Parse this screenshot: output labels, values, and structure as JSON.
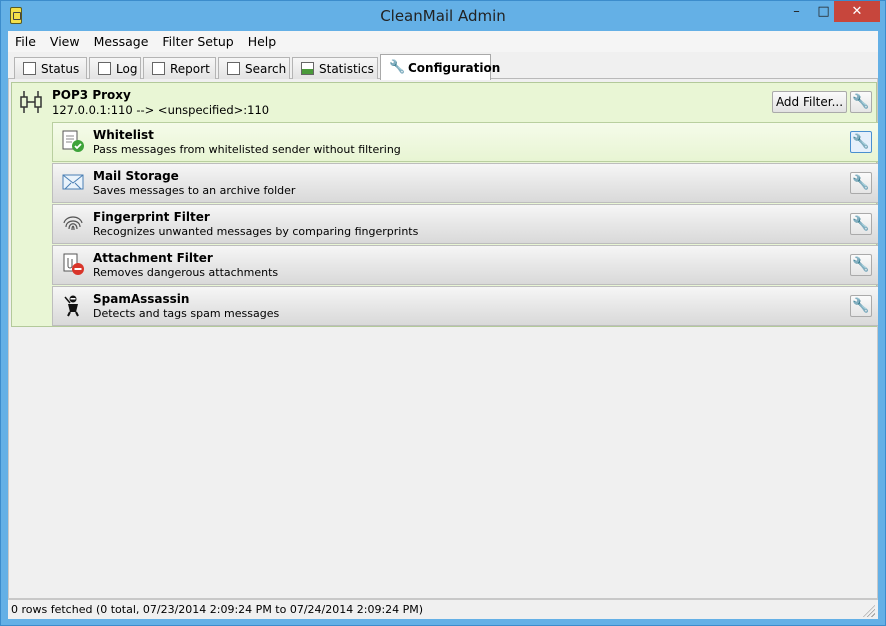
{
  "window": {
    "title": "CleanMail Admin",
    "min": "–",
    "max": "□",
    "close": "✕"
  },
  "menu": [
    "File",
    "View",
    "Message",
    "Filter Setup",
    "Help"
  ],
  "tabs": [
    {
      "label": "Status",
      "icon": "status-icon"
    },
    {
      "label": "Log",
      "icon": "log-icon"
    },
    {
      "label": "Report",
      "icon": "report-icon"
    },
    {
      "label": "Search",
      "icon": "search-icon"
    },
    {
      "label": "Statistics",
      "icon": "statistics-icon"
    },
    {
      "label": "Configuration",
      "icon": "wrench-icon",
      "active": true
    }
  ],
  "proxy": {
    "title": "POP3 Proxy",
    "address": "127.0.0.1:110 --> <unspecified>:110",
    "add_filter_label": "Add Filter...",
    "accent": "#e9f6d5"
  },
  "filters": [
    {
      "title": "Whitelist",
      "description": "Pass messages from whitelisted sender without filtering",
      "icon": "whitelist-icon",
      "selected": true
    },
    {
      "title": "Mail Storage",
      "description": "Saves messages to an archive folder",
      "icon": "mail-storage-icon"
    },
    {
      "title": "Fingerprint Filter",
      "description": "Recognizes unwanted messages by comparing fingerprints",
      "icon": "fingerprint-icon"
    },
    {
      "title": "Attachment Filter",
      "description": "Removes dangerous attachments",
      "icon": "attachment-icon"
    },
    {
      "title": "SpamAssassin",
      "description": "Detects and tags spam messages",
      "icon": "spamassassin-icon"
    }
  ],
  "status": {
    "text": "0 rows fetched (0 total, 07/23/2014 2:09:24 PM to 07/24/2014 2:09:24 PM)"
  },
  "colors": {
    "titlebar": "#64b0e6",
    "close": "#c7463c",
    "selected_row": "#e8f5d3"
  }
}
